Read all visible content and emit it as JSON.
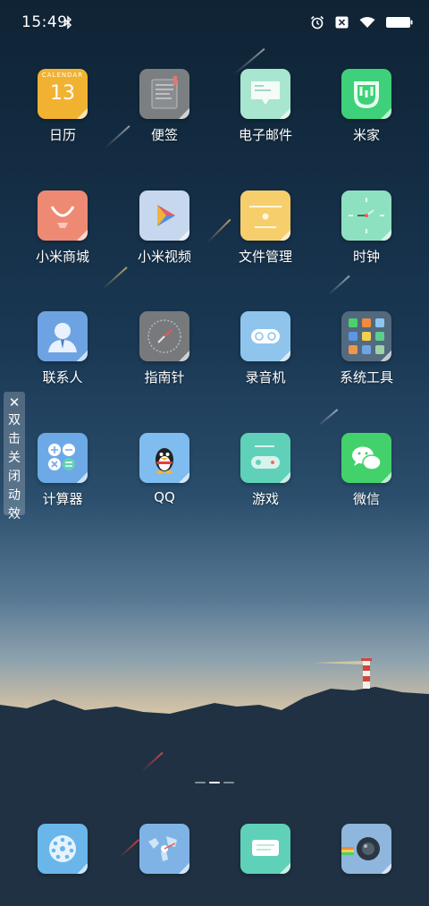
{
  "status_bar": {
    "time": "15:49",
    "icons": [
      "bluetooth-icon",
      "alarm-icon",
      "sim-off-icon",
      "wifi-icon",
      "battery-icon"
    ]
  },
  "side_panel": {
    "close_glyph": "✕",
    "text": "双击关闭动效"
  },
  "calendar": {
    "header": "CALENDAR",
    "day": "13"
  },
  "apps": [
    {
      "label": "日历"
    },
    {
      "label": "便签"
    },
    {
      "label": "电子邮件"
    },
    {
      "label": "米家"
    },
    {
      "label": "小米商城"
    },
    {
      "label": "小米视频"
    },
    {
      "label": "文件管理"
    },
    {
      "label": "时钟"
    },
    {
      "label": "联系人"
    },
    {
      "label": "指南针"
    },
    {
      "label": "录音机"
    },
    {
      "label": "系统工具"
    },
    {
      "label": "计算器"
    },
    {
      "label": "QQ"
    },
    {
      "label": "游戏"
    },
    {
      "label": "微信"
    }
  ],
  "page_indicator": {
    "pages": 3,
    "current": 2
  },
  "dock": [
    "phone-dialer",
    "browser",
    "messages",
    "camera"
  ],
  "colors": {
    "calendar": "#f2b231",
    "notes": "#7c7f82",
    "email": "#a8e6cf",
    "mijia": "#3ed07a",
    "mall": "#ee8a73",
    "video": "#c7d8ee",
    "files": "#f6cf6c",
    "clock": "#8ee1c0",
    "contacts": "#6ea3e3",
    "compass": "#77797c",
    "recorder": "#8fc4ec",
    "systools": "#ffffff",
    "calculator": "#6da9e6",
    "qq": "#7fbcef",
    "games": "#5fd1b8",
    "wechat": "#43d16b"
  }
}
